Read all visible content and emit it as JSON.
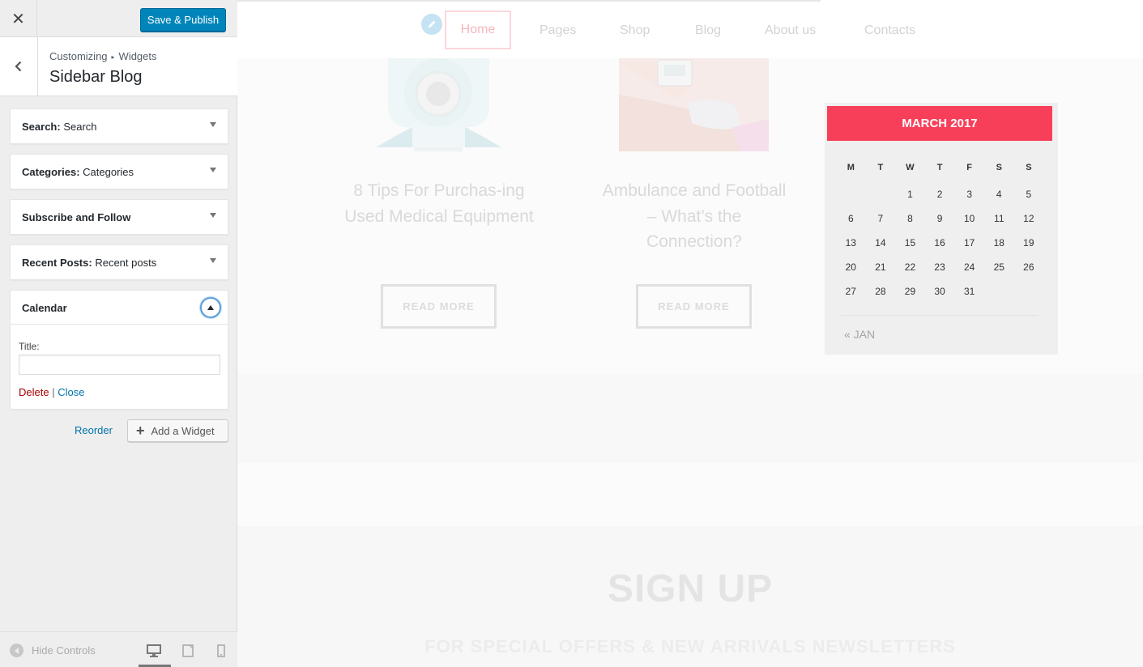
{
  "customizer": {
    "save_label": "Save & Publish",
    "breadcrumb": [
      "Customizing",
      "Widgets"
    ],
    "section_title": "Sidebar Blog",
    "widgets": [
      {
        "name": "Search",
        "title": "Search"
      },
      {
        "name": "Categories",
        "title": "Categories"
      },
      {
        "name": "Subscribe and Follow",
        "title": ""
      },
      {
        "name": "Recent Posts",
        "title": "Recent posts"
      },
      {
        "name": "Calendar",
        "title": ""
      }
    ],
    "calendar_form": {
      "title_label": "Title:",
      "title_value": "",
      "delete_label": "Delete",
      "separator": "|",
      "close_label": "Close"
    },
    "reorder_label": "Reorder",
    "add_widget_label": "Add a Widget",
    "hide_controls_label": "Hide Controls",
    "devices": [
      "desktop",
      "tablet",
      "mobile"
    ],
    "active_device": "desktop"
  },
  "preview": {
    "nav": [
      "Home",
      "Pages",
      "Shop",
      "Blog",
      "About us",
      "Contacts"
    ],
    "active_nav": "Home",
    "posts": [
      {
        "title": "8 Tips For Purchas-ing Used Medical Equipment",
        "button": "READ MORE"
      },
      {
        "title": "Ambulance and Football – What’s the Connection?",
        "button": "READ MORE"
      }
    ],
    "calendar": {
      "month": "MARCH 2017",
      "weekdays": [
        "M",
        "T",
        "W",
        "T",
        "F",
        "S",
        "S"
      ],
      "weeks": [
        [
          "",
          "",
          "1",
          "2",
          "3",
          "4",
          "5"
        ],
        [
          "6",
          "7",
          "8",
          "9",
          "10",
          "11",
          "12"
        ],
        [
          "13",
          "14",
          "15",
          "16",
          "17",
          "18",
          "19"
        ],
        [
          "20",
          "21",
          "22",
          "23",
          "24",
          "25",
          "26"
        ],
        [
          "27",
          "28",
          "29",
          "30",
          "31",
          "",
          ""
        ]
      ],
      "prev_link": "« JAN"
    },
    "signup_title": "SIGN UP",
    "signup_subtitle": "FOR SPECIAL OFFERS & NEW ARRIVALS NEWSLETTERS"
  },
  "colors": {
    "primary_button": "#0085ba",
    "calendar_header": "#f83f5a",
    "delete_link": "#aa0000",
    "link": "#0073aa"
  },
  "icons": [
    "close-icon",
    "back-chevron-icon",
    "pencil-icon",
    "plus-icon",
    "desktop-icon",
    "tablet-icon",
    "mobile-icon",
    "hide-controls-icon"
  ]
}
